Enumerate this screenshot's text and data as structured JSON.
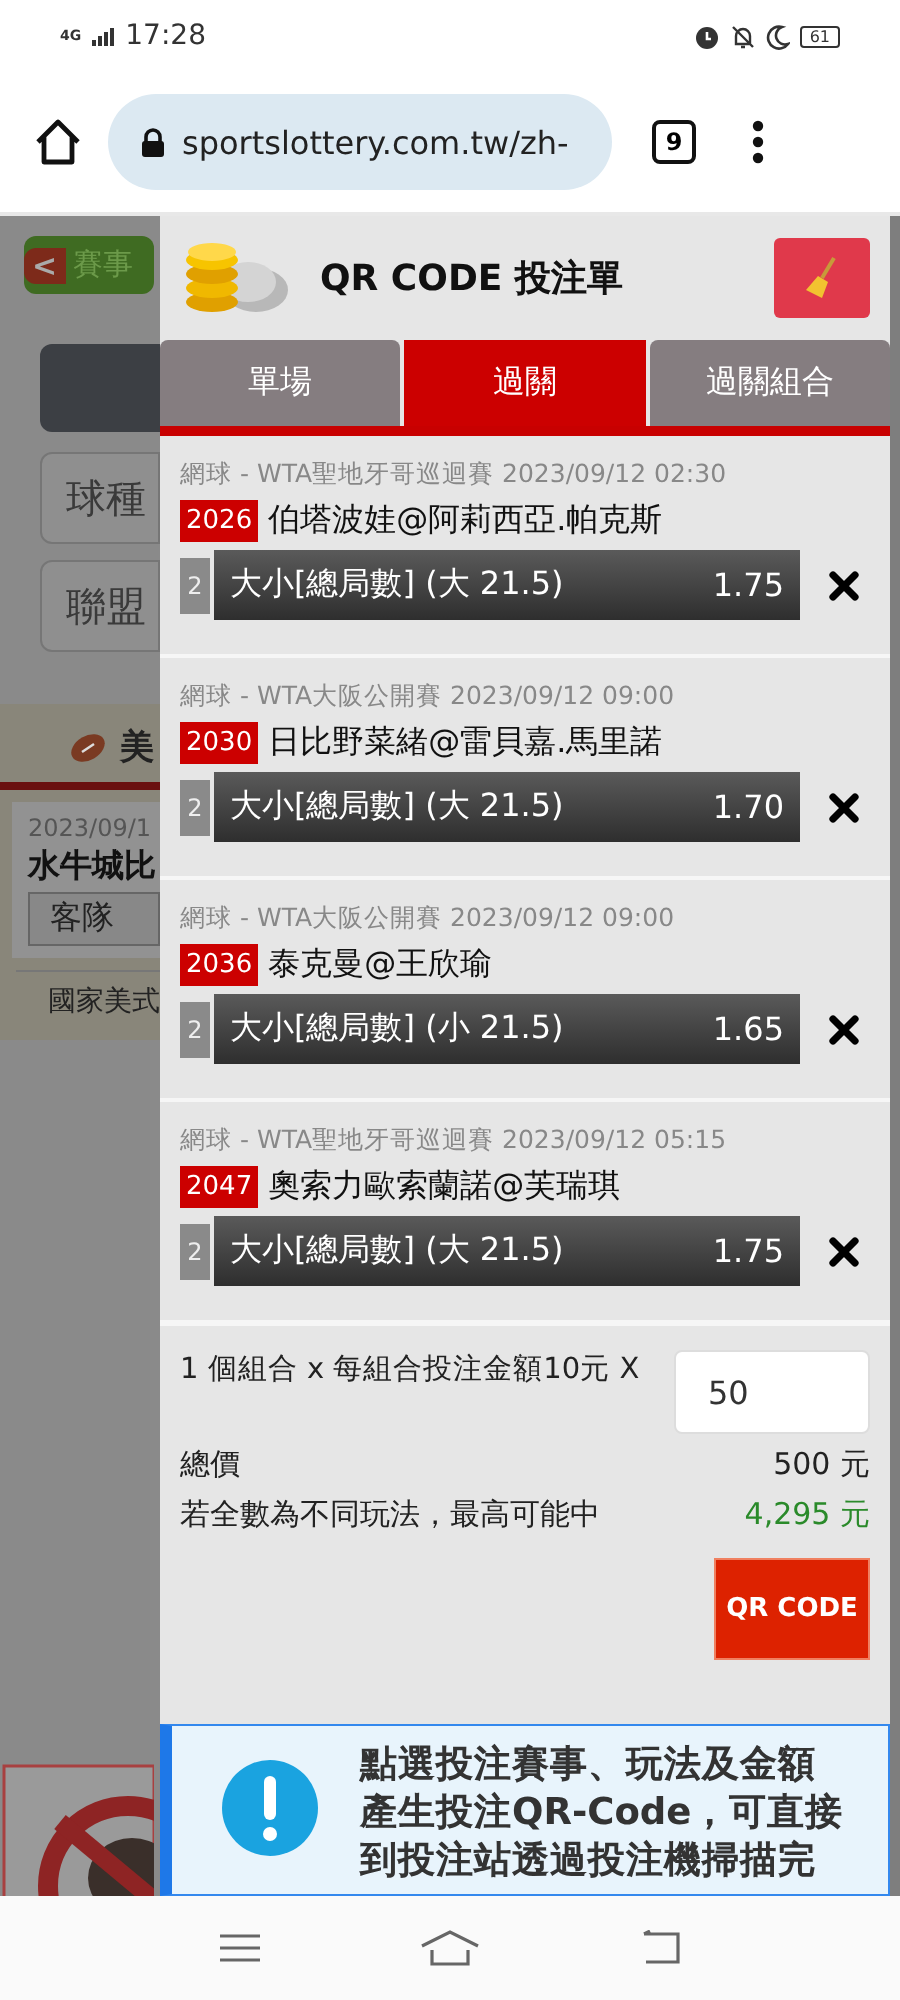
{
  "status_bar": {
    "network": "4G",
    "time": "17:28",
    "battery": "61"
  },
  "browser": {
    "url": "sportslottery.com.tw/zh-",
    "tab_count": "9"
  },
  "background_page": {
    "back_arrow": "<",
    "back_button": "賽事",
    "filters": [
      "球種",
      "聯盟"
    ],
    "section_title": "美",
    "match_date": "2023/09/1",
    "match_name": "水牛城比",
    "team_label": "客隊",
    "league": "國家美式"
  },
  "betslip": {
    "title": "QR CODE 投注單",
    "tabs": [
      {
        "label": "單場",
        "selected": false
      },
      {
        "label": "過關",
        "selected": true
      },
      {
        "label": "過關組合",
        "selected": false
      }
    ],
    "bets": [
      {
        "event": "網球 - WTA聖地牙哥巡迴賽 2023/09/12 02:30",
        "code": "2026",
        "match": "伯塔波娃@阿莉西亞.帕克斯",
        "count": "2",
        "market": "大小[總局數] (大 21.5)",
        "odds": "1.75"
      },
      {
        "event": "網球 - WTA大阪公開賽 2023/09/12 09:00",
        "code": "2030",
        "match": "日比野菜緒@雷貝嘉.馬里諾",
        "count": "2",
        "market": "大小[總局數] (大 21.5)",
        "odds": "1.70"
      },
      {
        "event": "網球 - WTA大阪公開賽 2023/09/12 09:00",
        "code": "2036",
        "match": "泰克曼@王欣瑜",
        "count": "2",
        "market": "大小[總局數] (小 21.5)",
        "odds": "1.65"
      },
      {
        "event": "網球 - WTA聖地牙哥巡迴賽 2023/09/12 05:15",
        "code": "2047",
        "match": "奧索力歐索蘭諾@芙瑞琪",
        "count": "2",
        "market": "大小[總局數] (大 21.5)",
        "odds": "1.75"
      }
    ],
    "summary": {
      "combo_text": "1 個組合 x 每組合投注金額10元 X",
      "stake": "50",
      "total_label": "總價",
      "total_value": "500 元",
      "max_label": "若全數為不同玩法，最高可能中",
      "max_value": "4,295 元",
      "button": "QR CODE"
    },
    "notice": "點選投注賽事、玩法及金額產生投注QR-Code，可直接到投注站透過投注機掃描完"
  }
}
